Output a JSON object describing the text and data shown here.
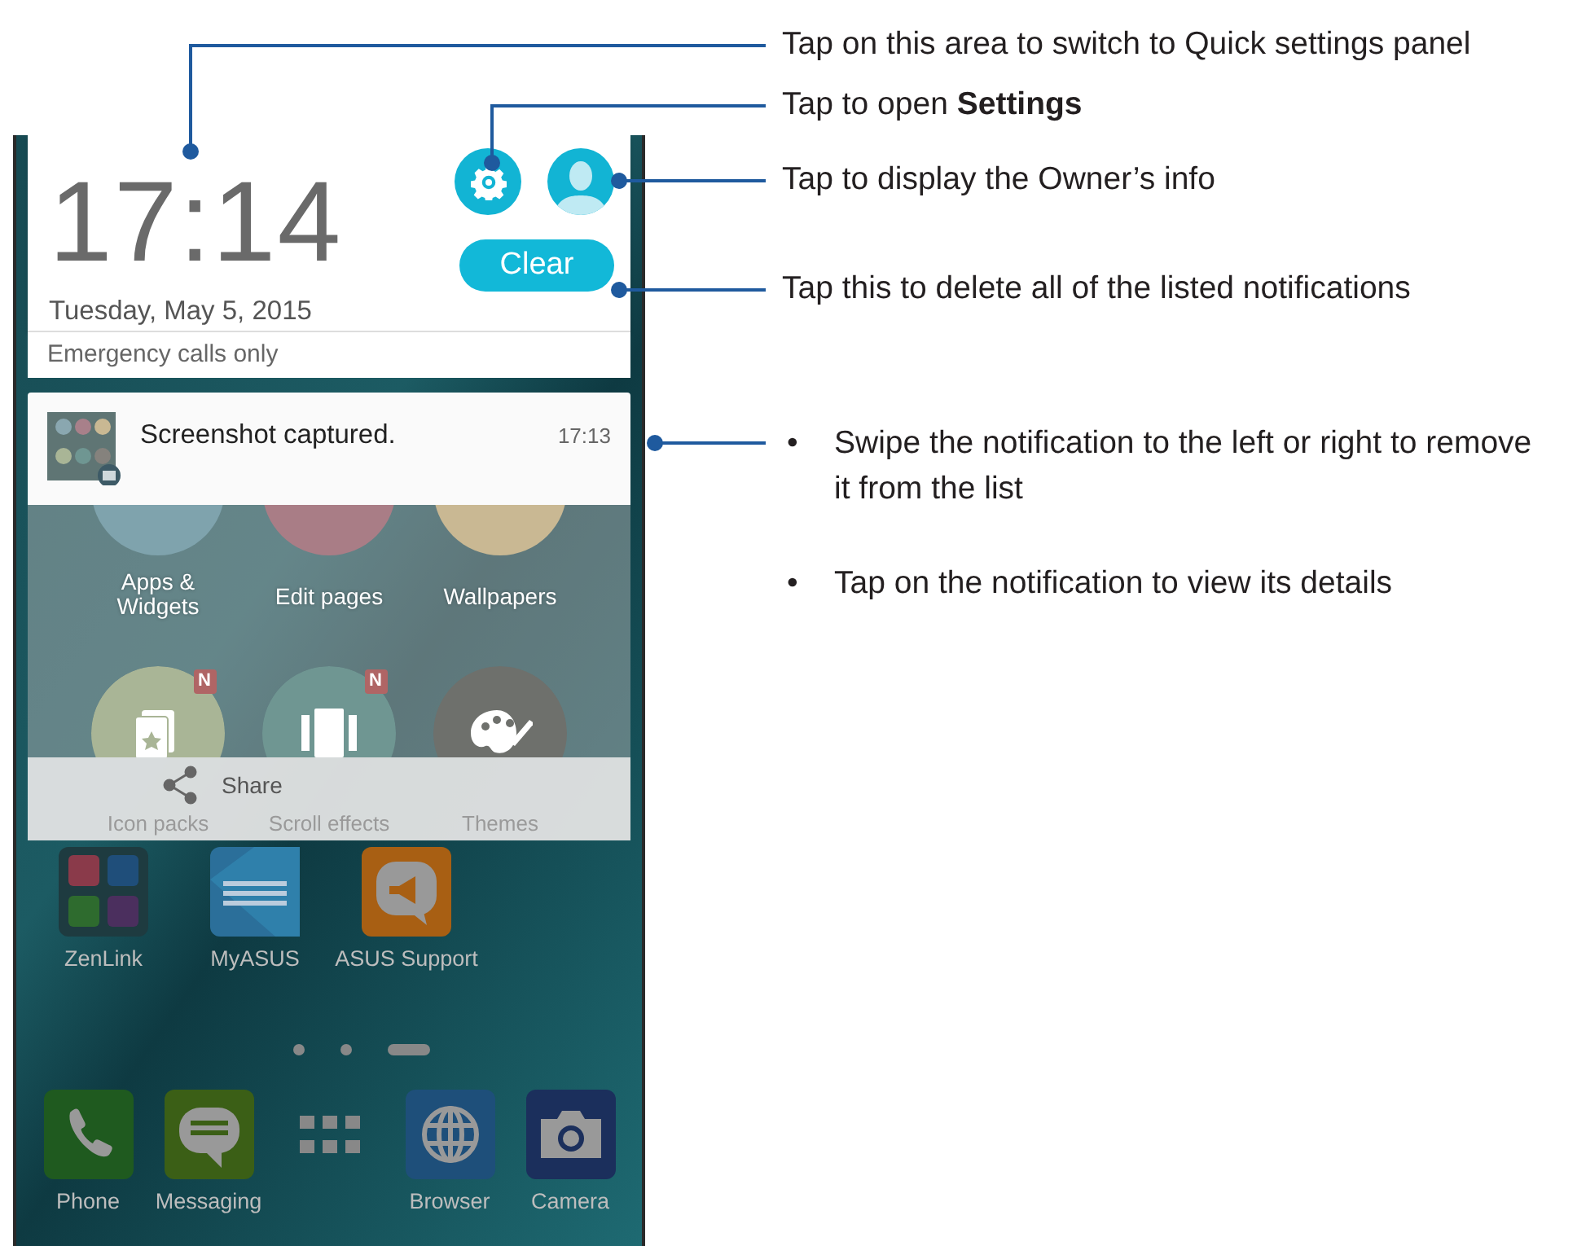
{
  "phone": {
    "clock": {
      "time": "17:14",
      "date": "Tuesday, May 5, 2015",
      "clear_button": "Clear"
    },
    "carrier_status": "Emergency calls only",
    "notification": {
      "title": "Screenshot captured.",
      "time": "17:13"
    },
    "quick_settings": [
      {
        "label": "Apps & Widgets",
        "kind": "apps",
        "color": "#7fa3ad"
      },
      {
        "label": "Edit pages",
        "kind": "pages",
        "color": "#a97d86"
      },
      {
        "label": "Wallpapers",
        "kind": "wallpaper",
        "color": "#c9b893"
      },
      {
        "label": "Icon packs",
        "kind": "iconpack",
        "color": "#a9b596",
        "badge": "N"
      },
      {
        "label": "Scroll effects",
        "kind": "scroll",
        "color": "#6f9692",
        "badge": "N"
      },
      {
        "label": "Themes",
        "kind": "themes",
        "color": "#6e706c"
      }
    ],
    "share": "Share",
    "apps": [
      {
        "label": "ZenLink",
        "kind": "folder"
      },
      {
        "label": "MyASUS",
        "kind": "myasus"
      },
      {
        "label": "ASUS Support",
        "kind": "support"
      }
    ],
    "page_dots": [
      {
        "selected": false
      },
      {
        "selected": false
      },
      {
        "selected": true
      }
    ],
    "dock": [
      {
        "label": "Phone",
        "kind": "phone"
      },
      {
        "label": "Messaging",
        "kind": "messaging"
      },
      {
        "kind": "apps"
      },
      {
        "label": "Browser",
        "kind": "browser"
      },
      {
        "label": "Camera",
        "kind": "camera"
      }
    ]
  },
  "callouts": [
    {
      "text": "Tap on this area to switch to Quick settings panel"
    },
    {
      "text": "Tap to open **Settings**"
    },
    {
      "text": "Tap to display the Owner’s info"
    },
    {
      "text": "Tap this to delete all of the listed notifications"
    }
  ],
  "bullets": [
    {
      "marker": "•",
      "text": "Swipe the notification to the left or right to remove it from the list"
    },
    {
      "marker": "•",
      "text": "Tap on the notification to view its details"
    }
  ]
}
